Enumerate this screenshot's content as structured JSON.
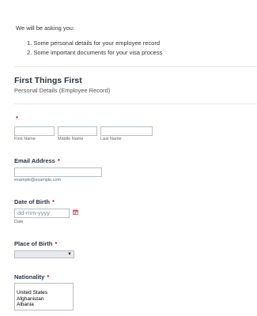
{
  "intro": {
    "text": "We will be asking you:",
    "items": [
      "1. Some personal details for your employee record",
      "2. Some important documents for your visa process"
    ]
  },
  "section": {
    "title": "First Things First",
    "subtitle": "Personal Details (Employee Record)"
  },
  "name_field": {
    "required_mark": "*",
    "first_label": "First Name",
    "middle_label": "Middle Name",
    "last_label": "Last Name",
    "first_value": "",
    "middle_value": "",
    "last_value": ""
  },
  "email_field": {
    "label": "Email Address",
    "required_mark": "*",
    "value": "",
    "sublabel": "example@example.com"
  },
  "dob_field": {
    "label": "Date of Birth",
    "required_mark": "*",
    "placeholder": "dd-mm-yyyy",
    "sublabel": "Date",
    "icon": "calendar-icon"
  },
  "pob_field": {
    "label": "Place of Birth",
    "required_mark": "*",
    "selected_value": "",
    "icon": "dropdown-arrow-icon"
  },
  "nationality_field": {
    "label": "Nationality",
    "required_mark": "*",
    "options": [
      "United States",
      "Afghanistan",
      "Albania"
    ]
  },
  "colors": {
    "required": "#dd0000",
    "heading": "#2c3345",
    "input_border": "#b8bdc9",
    "calendar_accent": "#c0424a"
  }
}
